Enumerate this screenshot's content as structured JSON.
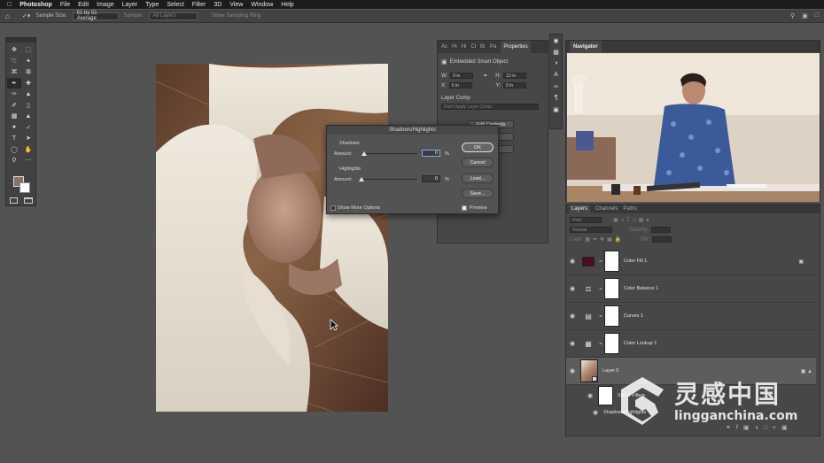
{
  "menubar": {
    "app": "Photoshop",
    "items": [
      "File",
      "Edit",
      "Image",
      "Layer",
      "Type",
      "Select",
      "Filter",
      "3D",
      "View",
      "Window",
      "Help"
    ]
  },
  "options": {
    "sample_size_label": "Sample Size:",
    "sample_size_value": "51 by 51 Average",
    "sample_label": "Sample:",
    "sample_value": "All Layers",
    "sampling_ring": "Show Sampling Ring"
  },
  "properties": {
    "tabs": [
      "Ac",
      "Hi",
      "Hi",
      "Cl",
      "Br",
      "Pa"
    ],
    "active_tab": "Properties",
    "object_type": "Embedded Smart Object",
    "w_label": "W:",
    "w_value": "0 in",
    "h_label": "H:",
    "h_value": "12 in",
    "x_label": "X:",
    "x_value": "0 in",
    "y_label": "Y:",
    "y_value": "0 in",
    "layer_comp_label": "Layer Comp",
    "layer_comp_value": "Don't Apply Layer Comp",
    "edit_contents": "Edit Contents"
  },
  "navigator": {
    "title": "Navigator"
  },
  "layers": {
    "tabs": [
      "Layers",
      "Channels",
      "Paths"
    ],
    "kind": "Kind",
    "blend": "Normal",
    "opacity": "Opacity:",
    "lock": "Lock:",
    "fill": "Fill:",
    "rows": [
      {
        "name": "Color Fill 1",
        "icon": "color-fill-icon"
      },
      {
        "name": "Color Balance 1",
        "icon": "color-balance-icon"
      },
      {
        "name": "Curves 1",
        "icon": "curves-icon"
      },
      {
        "name": "Color Lookup 1",
        "icon": "color-lookup-icon"
      },
      {
        "name": "Layer 0",
        "icon": "smart-object-icon"
      }
    ],
    "smart_filters": "Smart Filters",
    "filter_name": "Shadows/Highlights"
  },
  "dialog": {
    "title": "Shadows/Highlights",
    "shadows_label": "Shadows",
    "shadows_amount_label": "Amount:",
    "shadows_amount": "0",
    "highlights_label": "Highlights",
    "highlights_amount_label": "Amount:",
    "highlights_amount": "0",
    "percent": "%",
    "ok": "OK",
    "cancel": "Cancel",
    "load": "Load...",
    "save": "Save...",
    "show_more": "Show More Options",
    "preview": "Preview",
    "preview_checked": true,
    "show_more_checked": false
  },
  "colors": {
    "foreground": "#8a7268",
    "background": "#ffffff",
    "color_fill_swatch": "#4a0f28"
  },
  "watermark": {
    "chinese": "灵感中国",
    "latin": "lingganchina.com"
  }
}
